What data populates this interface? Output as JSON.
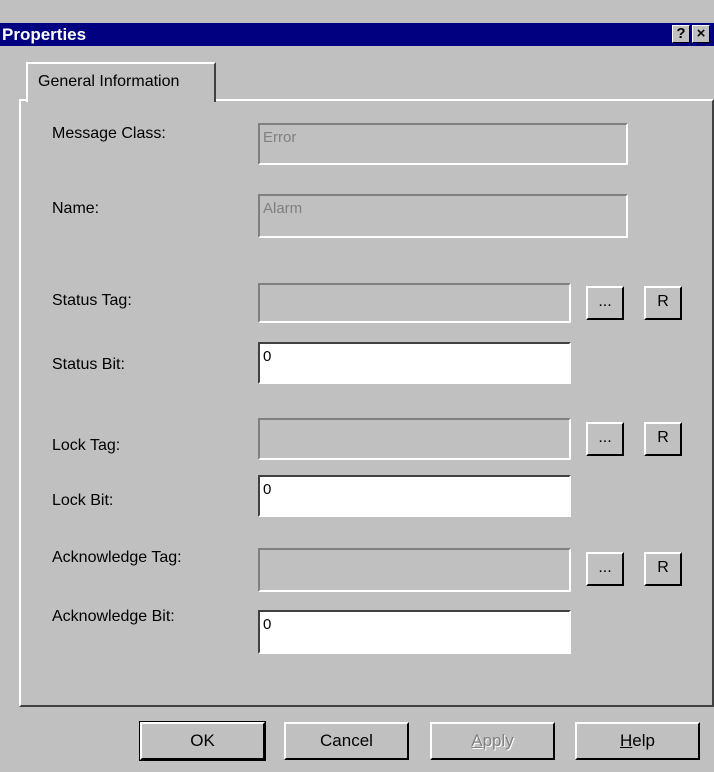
{
  "window": {
    "title": "Properties",
    "help_btn": "?",
    "close_btn": "×"
  },
  "tabs": [
    {
      "label": "General Information"
    }
  ],
  "form": {
    "message_class": {
      "label": "Message Class:",
      "value": "Error"
    },
    "name": {
      "label": "Name:",
      "value": "Alarm"
    },
    "status_tag": {
      "label": "Status Tag:",
      "value": ""
    },
    "status_bit": {
      "label": "Status Bit:",
      "value": "0"
    },
    "lock_tag": {
      "label": "Lock Tag:",
      "value": ""
    },
    "lock_bit": {
      "label": "Lock Bit:",
      "value": "0"
    },
    "acknowledge_tag": {
      "label": "Acknowledge Tag:",
      "value": ""
    },
    "acknowledge_bit": {
      "label": "Acknowledge Bit:",
      "value": "0"
    },
    "browse_label": "...",
    "remove_label": "R"
  },
  "buttons": {
    "ok": "OK",
    "cancel": "Cancel",
    "apply_mnemonic": "A",
    "apply_rest": "pply",
    "help_mnemonic": "H",
    "help_rest": "elp"
  }
}
